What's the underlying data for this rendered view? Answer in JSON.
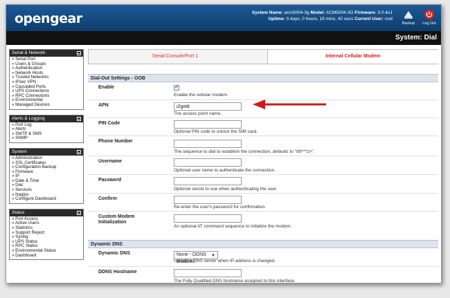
{
  "header": {
    "logo_text": "opengear",
    "system_name_label": "System Name:",
    "system_name": "acm5004-3g",
    "model_label": "Model:",
    "model": "ACM5004-3G",
    "firmware_label": "Firmware:",
    "firmware": "3.0.4u1",
    "uptime_label": "Uptime:",
    "uptime": "0 days, 0 hours, 19 mins, 42 secs",
    "current_user_label": "Current User:",
    "current_user": "root",
    "backup_label": "Backup",
    "logout_label": "Log Out"
  },
  "page_title": "System: Dial",
  "sidebar": {
    "serial_network": {
      "title": "Serial & Network",
      "items": [
        "Serial Port",
        "Users & Groups",
        "Authentication",
        "Network Hosts",
        "Trusted Networks",
        "IPsec VPN",
        "Cascaded Ports",
        "UPS Connections",
        "RPC Connections",
        "Environmental",
        "Managed Devices"
      ]
    },
    "alerts_logging": {
      "title": "Alerts & Logging",
      "items": [
        "Port Log",
        "Alerts",
        "SMTP & SMS",
        "SNMP"
      ]
    },
    "system": {
      "title": "System",
      "items": [
        "Administration",
        "SSL Certificates",
        "Configuration Backup",
        "Firmware",
        "IP",
        "Date & Time",
        "Dial",
        "Services",
        "Nagios",
        "Configure Dashboard"
      ]
    },
    "status": {
      "title": "Status",
      "items": [
        "Port Access",
        "Active Users",
        "Statistics",
        "Support Report",
        "Syslog",
        "UPS Status",
        "RPC Status",
        "Environmental Status",
        "Dashboard"
      ]
    }
  },
  "tabs": {
    "tab1": "Serial Console/Port 1",
    "tab2": "Internal Cellular Modem"
  },
  "dialout": {
    "title": "Dial-Out Settings - OOB",
    "enable_label": "Enable",
    "enable_checked": true,
    "enable_desc": "Enable the cellular modem.",
    "apn_label": "APN",
    "apn_value": "i2gold",
    "apn_desc": "The access point name.",
    "pin_label": "PIN Code",
    "pin_value": "",
    "pin_desc": "Optional PIN code to unlock the SIM card.",
    "phone_label": "Phone Number",
    "phone_value": "",
    "phone_desc": "The sequence to dial to establish the connection,",
    "phone_desc_default": "defaults to \"99***1#\".",
    "username_label": "Username",
    "username_value": "",
    "username_desc": "Optional user name to authenticate the connection.",
    "password_label": "Password",
    "password_value": "",
    "password_desc": "Optional secret to use when authenticating the user.",
    "confirm_label": "Confirm",
    "confirm_value": "",
    "confirm_desc": "Re-enter the user's password for confirmation.",
    "custom_label": "Custom Modem Initialization",
    "custom_value": "",
    "custom_desc": "An optional AT command sequence to initialize the modem."
  },
  "dyndns": {
    "title": "Dynamic DNS",
    "dns_label": "Dynamic DNS",
    "dns_selected": "None - DDNS disabled",
    "dns_desc": "Update a DNS server when IP address is changed.",
    "hostname_label": "DDNS Hostname",
    "hostname_value": "",
    "hostname_desc": "The Fully Qualified DNS hostname assigned to this interface."
  },
  "colors": {
    "header_blue": "#0d3d6c",
    "tab_text_red": "#cc3322",
    "annotation_red": "#cc1a1a",
    "section_header": "#dbe4ee"
  }
}
